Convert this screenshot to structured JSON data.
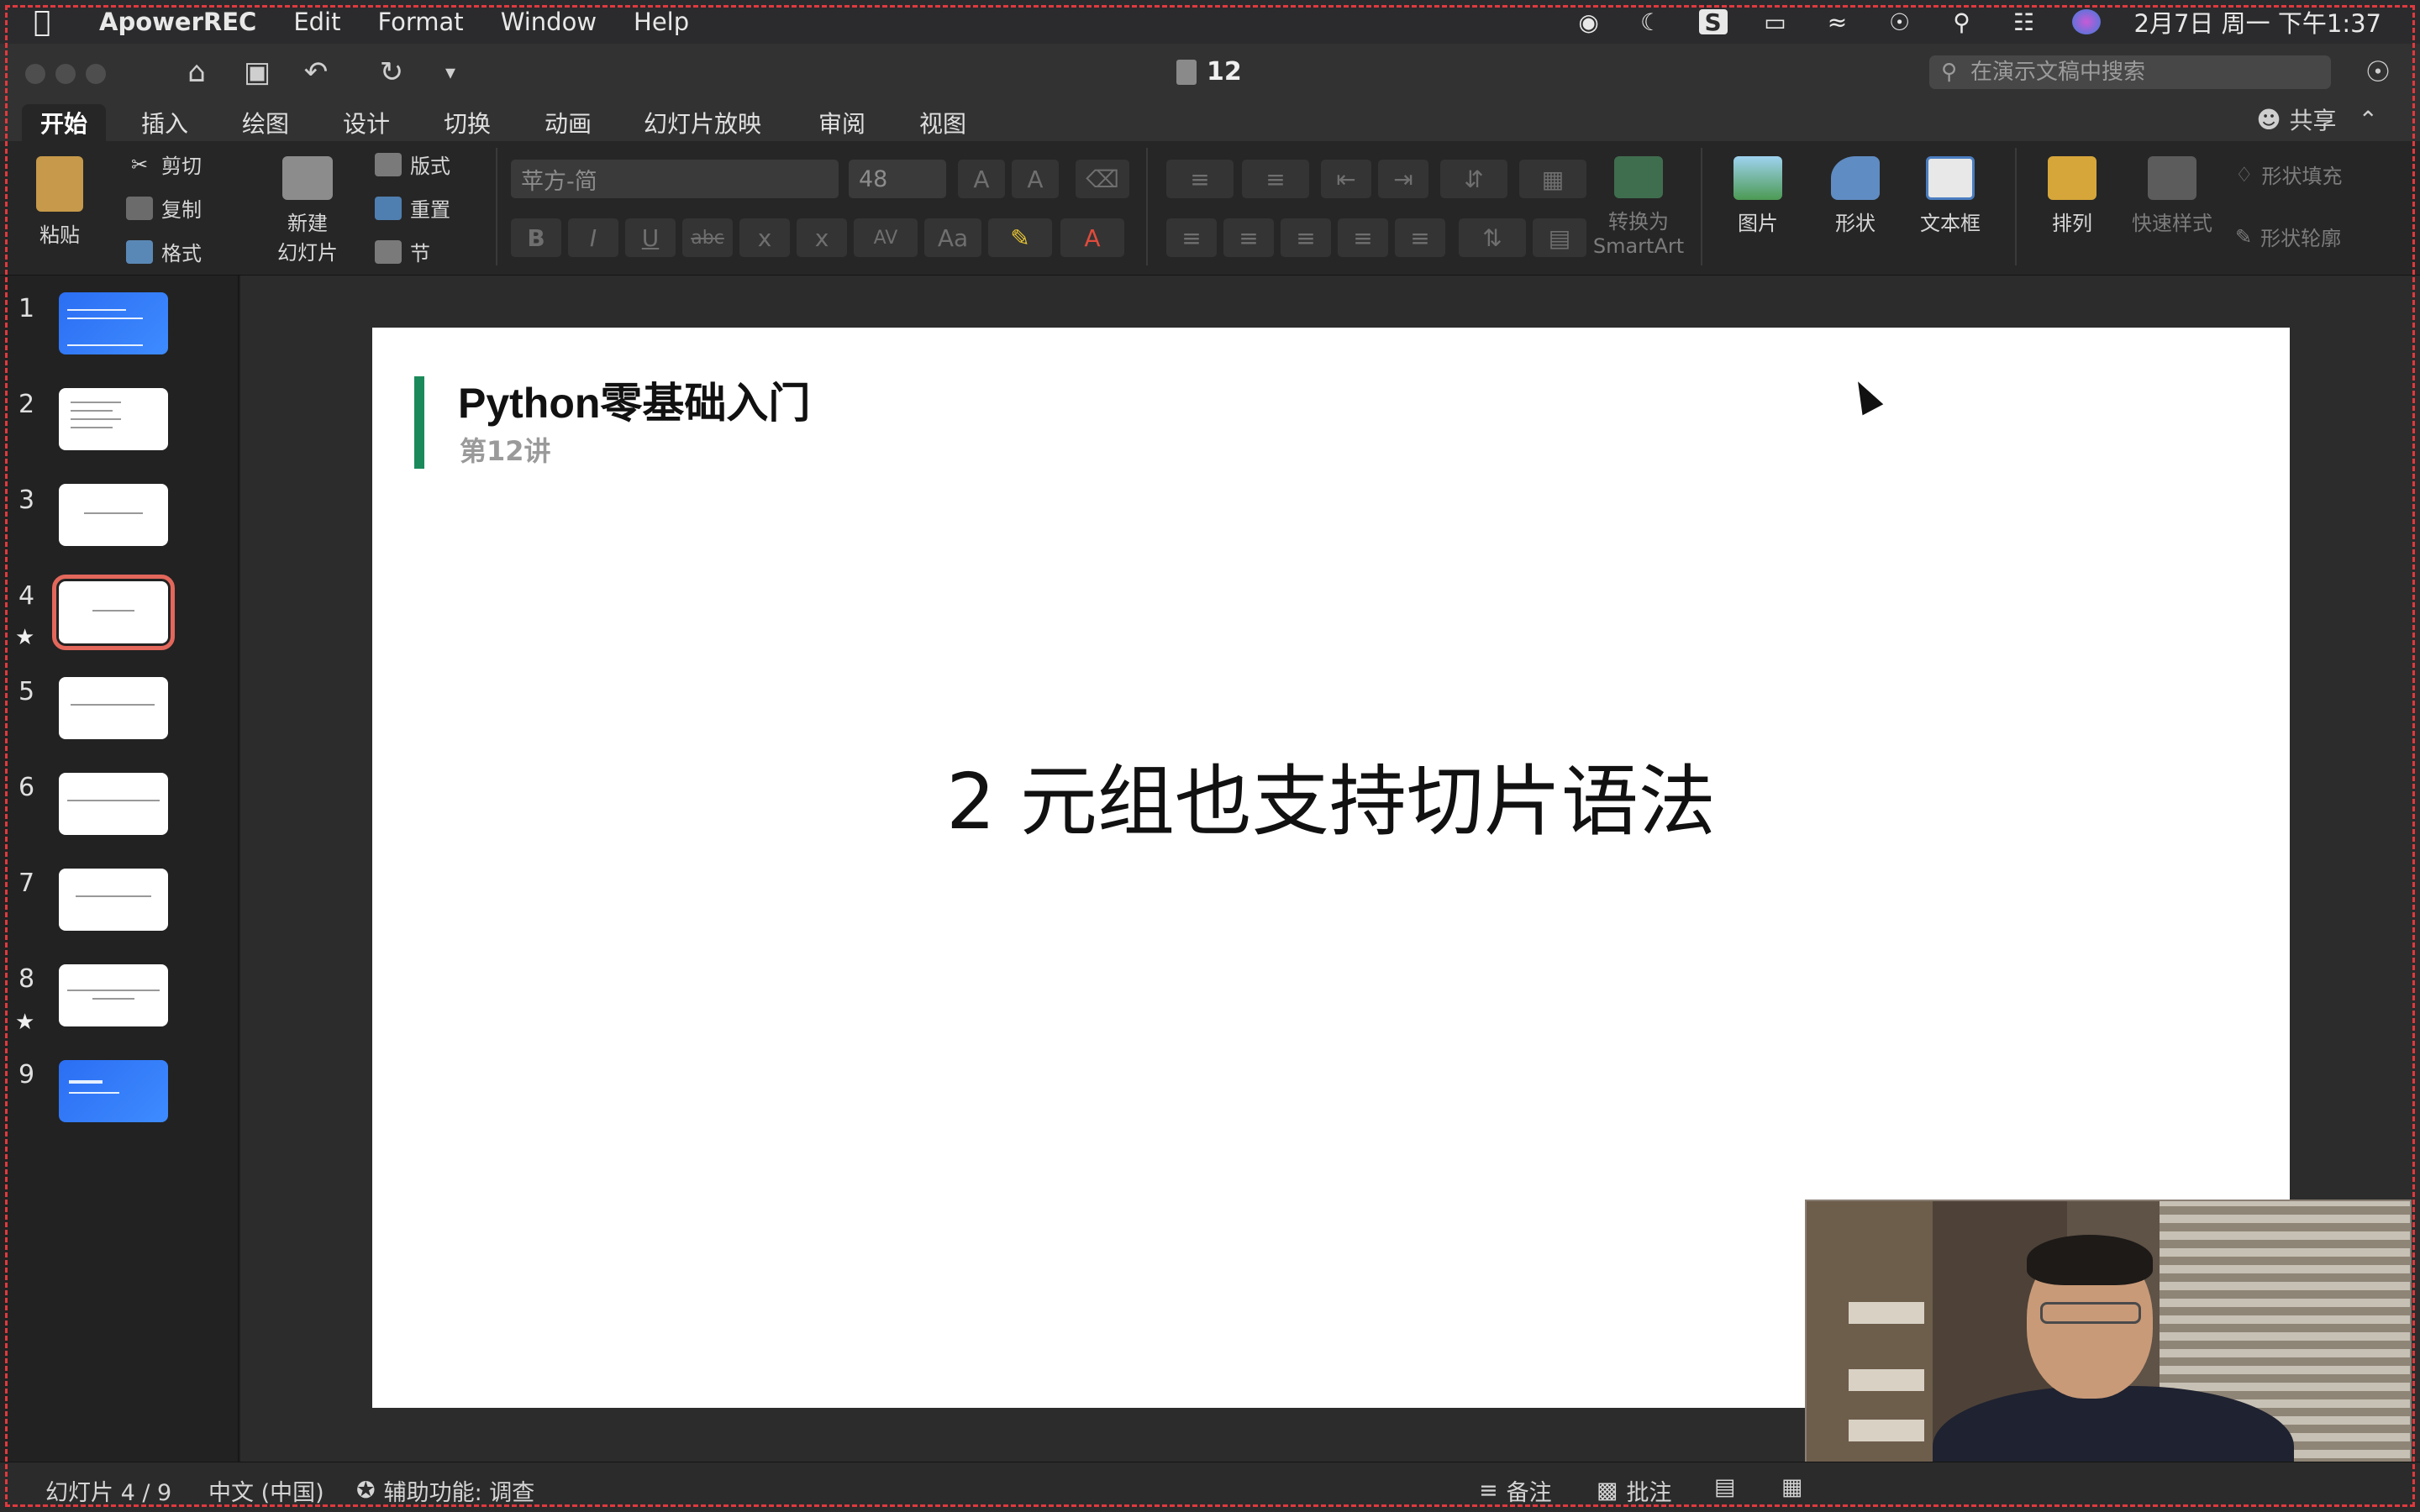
{
  "menubar": {
    "app_name": "ApowerREC",
    "menus": [
      "Edit",
      "Format",
      "Window",
      "Help"
    ],
    "clock": "2月7日 周一 下午1:37"
  },
  "window": {
    "doc_title": "12",
    "search_placeholder": "在演示文稿中搜索"
  },
  "ribbon_tabs": [
    "开始",
    "插入",
    "绘图",
    "设计",
    "切换",
    "动画",
    "幻灯片放映",
    "审阅",
    "视图"
  ],
  "share_label": "共享",
  "ribbon": {
    "paste": "粘贴",
    "cut": "剪切",
    "copy": "复制",
    "format_painter": "格式",
    "new_slide_1": "新建",
    "new_slide_2": "幻灯片",
    "layout": "版式",
    "reset": "重置",
    "section": "节",
    "font_name": "苹方-简",
    "font_size": "48",
    "bold": "B",
    "italic": "I",
    "underline": "U",
    "strike": "abc",
    "to_smartart_1": "转换为",
    "to_smartart_2": "SmartArt",
    "picture": "图片",
    "shape": "形状",
    "textbox": "文本框",
    "arrange": "排列",
    "quick_styles": "快速样式",
    "shape_fill": "形状填充",
    "shape_outline": "形状轮廓"
  },
  "thumbnails": [
    "1",
    "2",
    "3",
    "4",
    "5",
    "6",
    "7",
    "8",
    "9"
  ],
  "slide": {
    "title": "Python零基础入门",
    "subtitle": "第12讲",
    "body": "2 元组也支持切片语法"
  },
  "statusbar": {
    "slide_count": "幻灯片 4 / 9",
    "language": "中文 (中国)",
    "accessibility": "辅助功能: 调查",
    "notes": "备注",
    "comments": "批注"
  },
  "colors": {
    "accent_green": "#1b8a5a",
    "selection_red": "#e3675b",
    "record_border": "#e0393e"
  }
}
